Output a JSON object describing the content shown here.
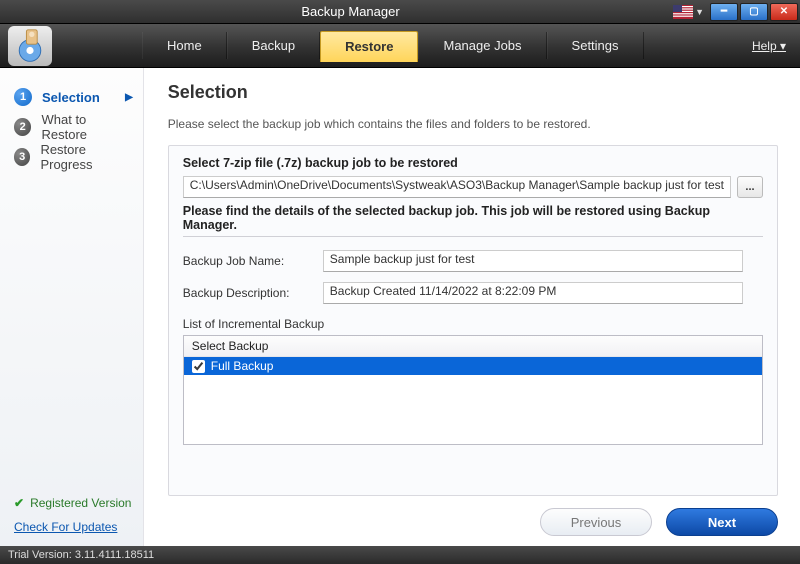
{
  "window": {
    "title": "Backup Manager"
  },
  "menu": {
    "home": "Home",
    "backup": "Backup",
    "restore": "Restore",
    "manage": "Manage Jobs",
    "settings": "Settings",
    "help": "Help"
  },
  "steps": {
    "s1": {
      "num": "1",
      "label": "Selection"
    },
    "s2": {
      "num": "2",
      "label": "What to Restore"
    },
    "s3": {
      "num": "3",
      "label": "Restore Progress"
    }
  },
  "sidebar": {
    "registered": "Registered Version",
    "updates": "Check For Updates"
  },
  "content": {
    "heading": "Selection",
    "instruction": "Please select the backup job which contains the files and folders to be restored.",
    "select7z": "Select 7-zip file (.7z) backup job to be restored",
    "path": "C:\\Users\\Admin\\OneDrive\\Documents\\Systweak\\ASO3\\Backup Manager\\Sample backup just for test",
    "browse": "...",
    "details": "Please find the details of the selected backup job. This job will be restored using Backup Manager.",
    "jobname_label": "Backup Job Name:",
    "jobname_value": "Sample backup just for test",
    "desc_label": "Backup Description:",
    "desc_value": "Backup Created 11/14/2022 at 8:22:09 PM",
    "list_label": "List of Incremental Backup",
    "list_header": "Select Backup",
    "list_item_0": "Full Backup",
    "prev": "Previous",
    "next": "Next"
  },
  "status": {
    "trial": "Trial Version: 3.11.4111.18511"
  }
}
